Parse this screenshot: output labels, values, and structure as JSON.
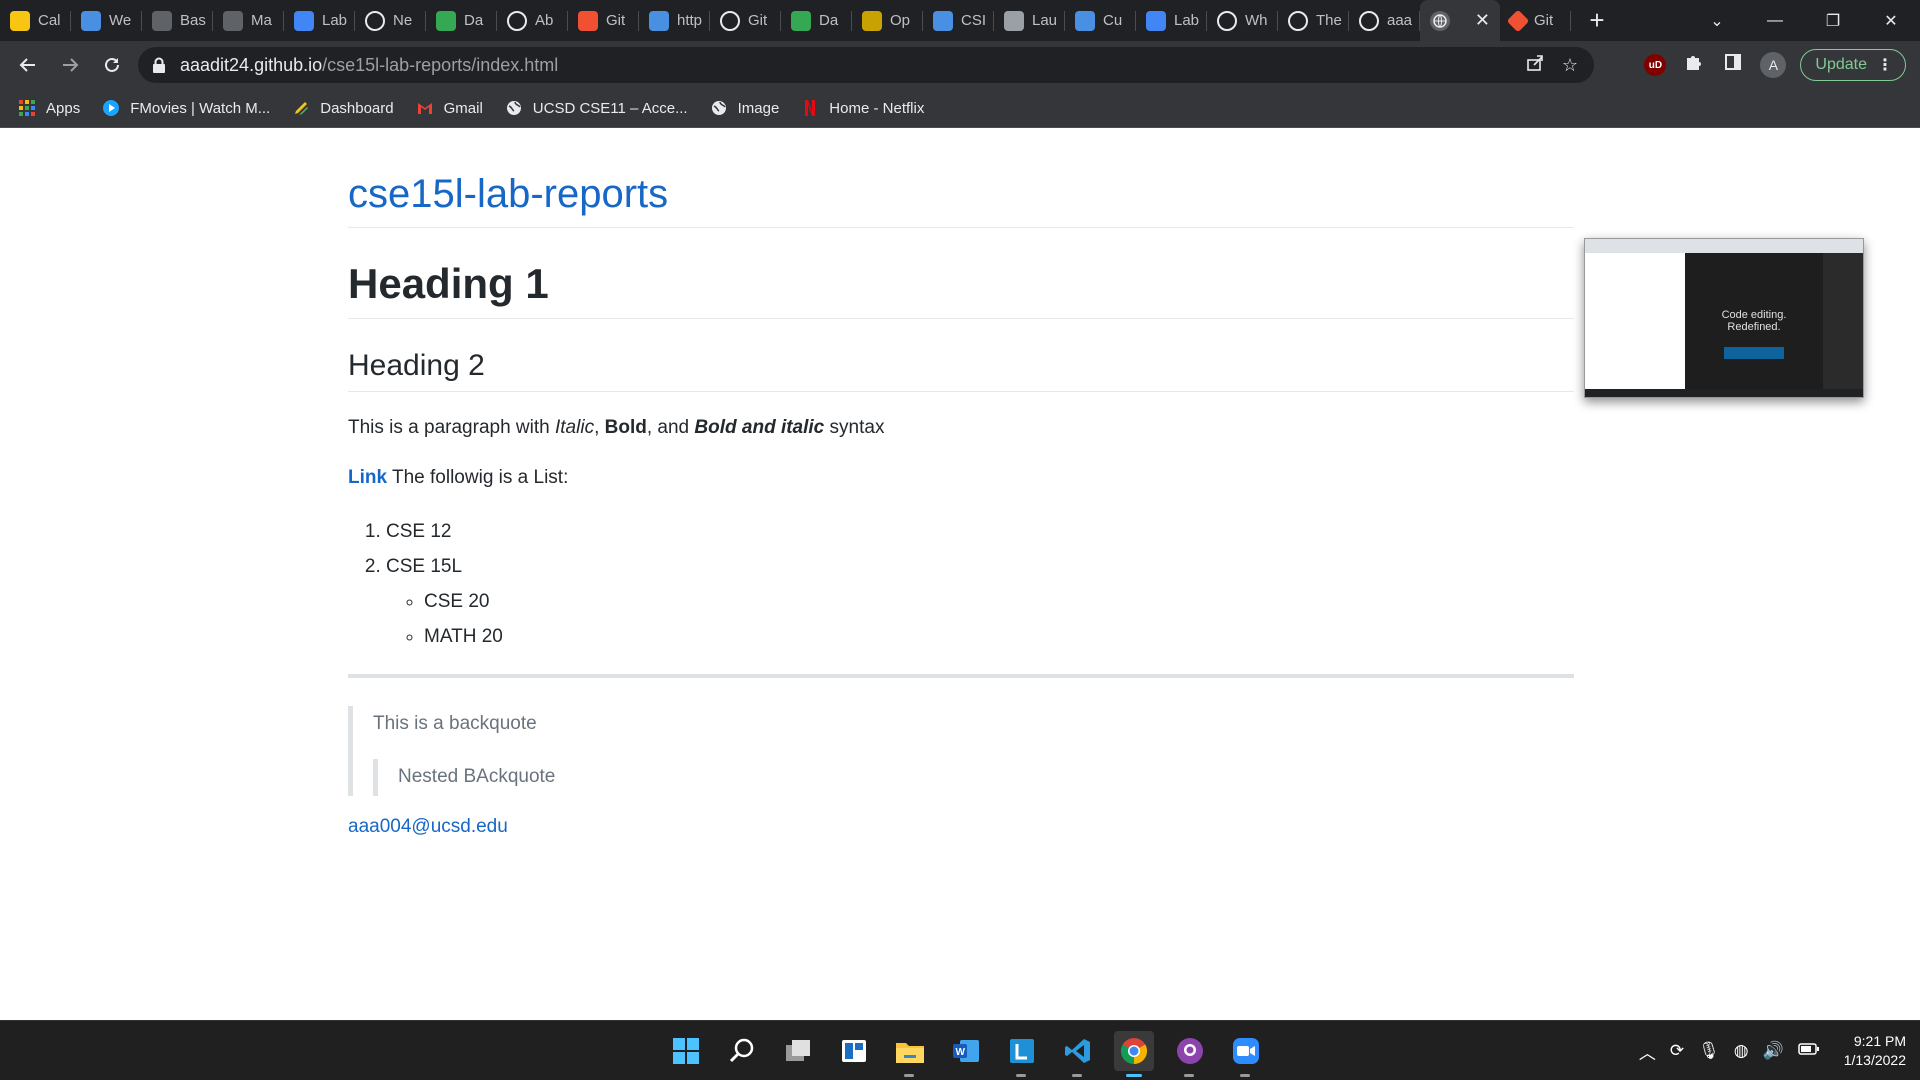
{
  "browser": {
    "tabs": [
      {
        "label": "Cal",
        "icon": "pencil-icon",
        "color": "#f9c513"
      },
      {
        "label": "We",
        "icon": "globe-check-icon",
        "color": "#4a90e2"
      },
      {
        "label": "Bas",
        "icon": "md-icon",
        "color": "#5f6368"
      },
      {
        "label": "Ma",
        "icon": "md-icon",
        "color": "#5f6368"
      },
      {
        "label": "Lab",
        "icon": "docs-icon",
        "color": "#4285f4"
      },
      {
        "label": "Ne",
        "icon": "github-icon",
        "color": "#ffffff"
      },
      {
        "label": "Da",
        "icon": "bar-chart-icon",
        "color": "#34a853"
      },
      {
        "label": "Ab",
        "icon": "github-icon",
        "color": "#ffffff"
      },
      {
        "label": "Git",
        "icon": "git-icon",
        "color": "#f05133"
      },
      {
        "label": "http",
        "icon": "search-box-icon",
        "color": "#4a90e2"
      },
      {
        "label": "Git",
        "icon": "github-icon",
        "color": "#ffffff"
      },
      {
        "label": "Da",
        "icon": "bar-chart-icon",
        "color": "#34a853"
      },
      {
        "label": "Op",
        "icon": "gear-bee-icon",
        "color": "#c8a200"
      },
      {
        "label": "CSI",
        "icon": "p-icon",
        "color": "#4a90e2"
      },
      {
        "label": "Lau",
        "icon": "globe-icon",
        "color": "#9aa0a6"
      },
      {
        "label": "Cu",
        "icon": "photo-icon",
        "color": "#4a90e2"
      },
      {
        "label": "Lab",
        "icon": "docs-icon",
        "color": "#4285f4"
      },
      {
        "label": "Wh",
        "icon": "google-icon",
        "color": "#ffffff"
      },
      {
        "label": "The",
        "icon": "github-icon",
        "color": "#ffffff"
      },
      {
        "label": "aaa",
        "icon": "github-icon",
        "color": "#ffffff"
      }
    ],
    "active_tab": {
      "label": "",
      "close": "✕"
    },
    "last_tab": {
      "label": "Git",
      "icon": "git-icon",
      "color": "#f05133"
    },
    "new_tab": "+",
    "url_host": "aaadit24.github.io",
    "url_path": "/cse15l-lab-reports/index.html",
    "update_label": "Update",
    "profile_initial": "A",
    "ublock_label": "uD"
  },
  "bookmarks": [
    {
      "label": "Apps",
      "icon": "apps-grid-icon"
    },
    {
      "label": "FMovies | Watch M...",
      "icon": "play-icon"
    },
    {
      "label": "Dashboard",
      "icon": "pencil-icon"
    },
    {
      "label": "Gmail",
      "icon": "gmail-icon"
    },
    {
      "label": "UCSD CSE11 – Acce...",
      "icon": "globe-icon"
    },
    {
      "label": "Image",
      "icon": "globe-icon"
    },
    {
      "label": "Home - Netflix",
      "icon": "netflix-icon"
    }
  ],
  "page": {
    "site_title": "cse15l-lab-reports",
    "heading1": "Heading 1",
    "heading2": "Heading 2",
    "para": {
      "p1": "This is a paragraph with ",
      "italic": "Italic",
      "p2": ", ",
      "bold": "Bold",
      "p3": ", and ",
      "bold_italic": "Bold and italic",
      "p4": " syntax"
    },
    "link_text": "Link",
    "link_follow": " The followig is a List:",
    "list": [
      "CSE 12",
      "CSE 15L"
    ],
    "sublist": [
      "CSE 20",
      "MATH 20"
    ],
    "blockquote": "This is a backquote",
    "nested_blockquote": "Nested BAckquote",
    "email": "aaa004@ucsd.edu",
    "thumbnail_text_1": "Code editing.",
    "thumbnail_text_2": "Redefined."
  },
  "taskbar": {
    "apps": [
      {
        "name": "start-icon",
        "active": false
      },
      {
        "name": "search-icon",
        "active": false
      },
      {
        "name": "task-view-icon",
        "active": false
      },
      {
        "name": "widgets-icon",
        "active": false
      },
      {
        "name": "file-explorer-icon",
        "active": false
      },
      {
        "name": "word-icon",
        "active": false
      },
      {
        "name": "lyx-icon",
        "active": false
      },
      {
        "name": "vscode-icon",
        "active": false
      },
      {
        "name": "chrome-icon",
        "active": true
      },
      {
        "name": "github-desktop-icon",
        "active": false
      },
      {
        "name": "zoom-icon",
        "active": false
      }
    ],
    "time": "9:21 PM",
    "date": "1/13/2022"
  }
}
